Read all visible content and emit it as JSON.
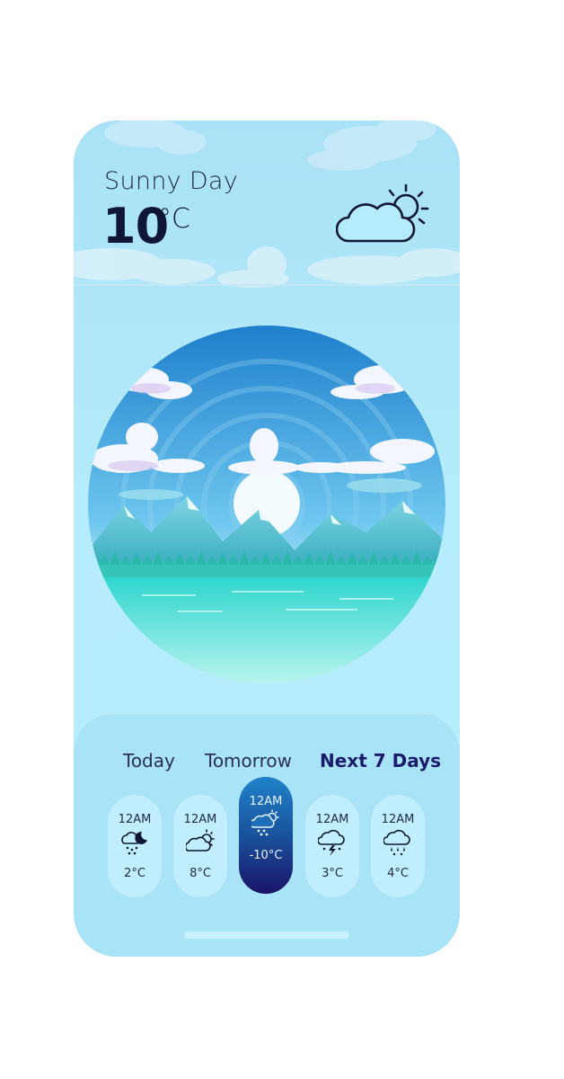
{
  "weather": {
    "condition": "Sunny Day",
    "temperature": "10",
    "unit": "°C",
    "icon": "cloud-sun-icon"
  },
  "forecast_tabs": [
    {
      "label": "Today",
      "active": false
    },
    {
      "label": "Tomorrow",
      "active": false
    },
    {
      "label": "Next 7 Days",
      "active": true
    }
  ],
  "hourly": [
    {
      "time": "12AM",
      "icon": "night-rain-icon",
      "temp": "2°C",
      "active": false
    },
    {
      "time": "12AM",
      "icon": "cloud-sun-icon",
      "temp": "8°C",
      "active": false
    },
    {
      "time": "12AM",
      "icon": "snow-sun-icon",
      "temp": "-10°C",
      "active": true
    },
    {
      "time": "12AM",
      "icon": "thunderstorm-icon",
      "temp": "3°C",
      "active": false
    },
    {
      "time": "12AM",
      "icon": "rain-icon",
      "temp": "4°C",
      "active": false
    }
  ],
  "colors": {
    "background": "#b5ecfb",
    "panel": "#a9e3f7",
    "active_card_top": "#1f83c9",
    "active_card_bottom": "#1a1468",
    "text_dark": "#0f1636"
  }
}
